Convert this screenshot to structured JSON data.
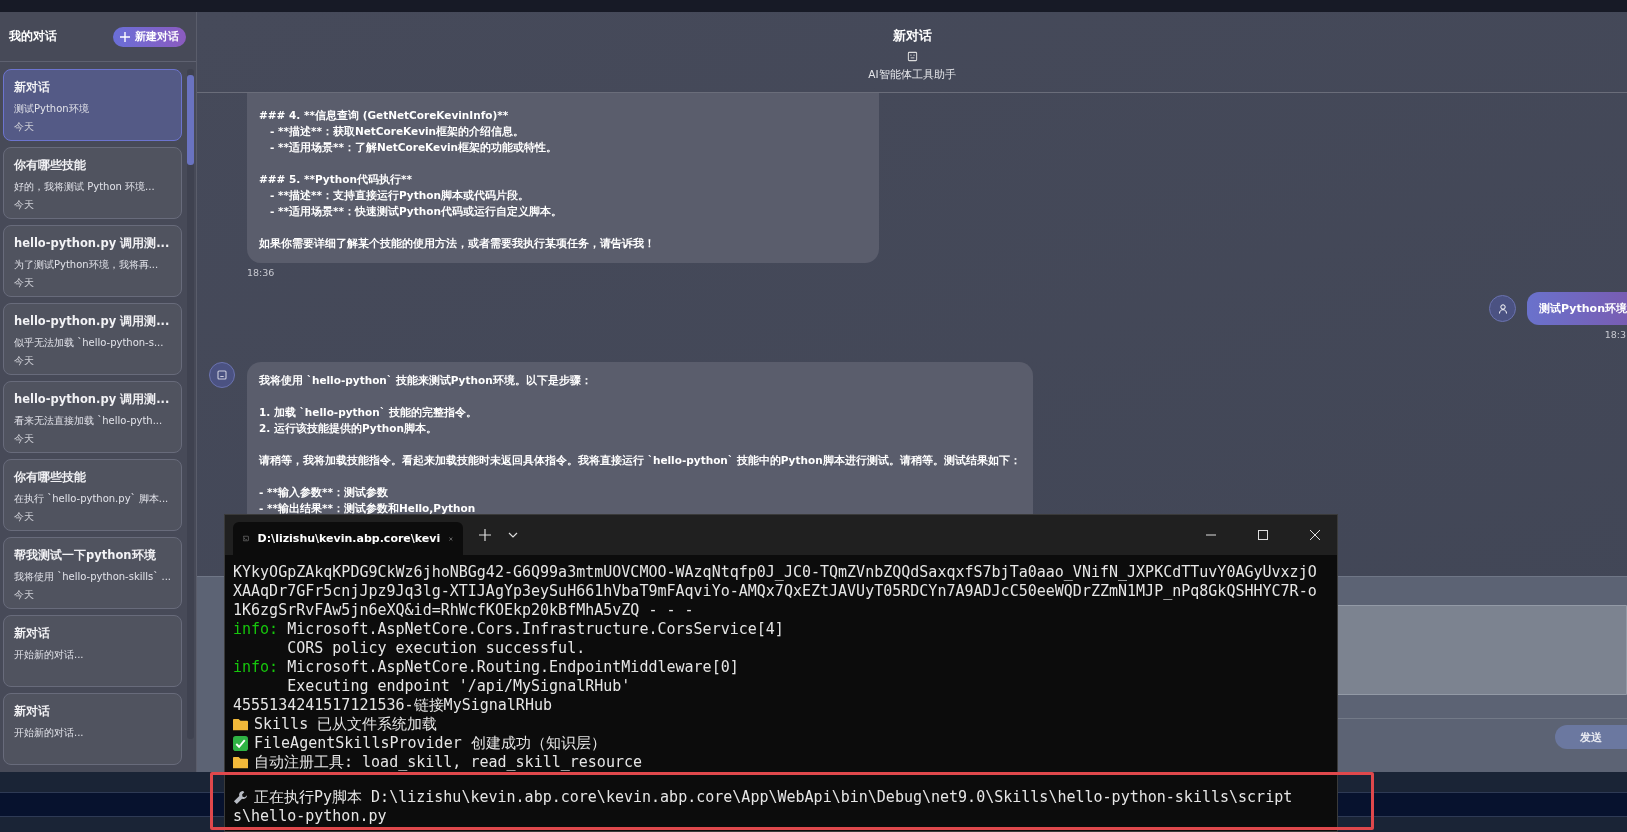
{
  "sidebar": {
    "title": "我的对话",
    "new_button": "新建对话",
    "items": [
      {
        "title": "新对话",
        "preview": "测试Python环境",
        "date": "今天",
        "selected": true
      },
      {
        "title": "你有哪些技能",
        "preview": "好的，我将测试 Python 环境...",
        "date": "今天",
        "selected": false
      },
      {
        "title": "hello-python.py 调用测...",
        "preview": "为了测试Python环境，我将再...",
        "date": "今天",
        "selected": false
      },
      {
        "title": "hello-python.py 调用测...",
        "preview": "似乎无法加载 `hello-python-s...",
        "date": "今天",
        "selected": false
      },
      {
        "title": "hello-python.py 调用测...",
        "preview": "看来无法直接加载 `hello-pyth...",
        "date": "今天",
        "selected": false
      },
      {
        "title": "你有哪些技能",
        "preview": "在执行 `hello-python.py` 脚本...",
        "date": "今天",
        "selected": false
      },
      {
        "title": "帮我测试一下python环境",
        "preview": "我将使用 `hello-python-skills` ...",
        "date": "今天",
        "selected": false
      },
      {
        "title": "新对话",
        "preview": "开始新的对话...",
        "selected": false
      },
      {
        "title": "新对话",
        "preview": "开始新的对话...",
        "selected": false
      }
    ]
  },
  "chat": {
    "title": "新对话",
    "subtitle": "AI智能体工具助手",
    "messages": [
      {
        "kind": "assistant",
        "time": "18:36",
        "paragraphs": [
          [
            "### 4. **信息查询 (GetNetCoreKevinInfo)**",
            "   - **描述**：获取NetCoreKevin框架的介绍信息。",
            "   - **适用场景**：了解NetCoreKevin框架的功能或特性。"
          ],
          [
            "### 5. **Python代码执行**",
            "   - **描述**：支持直接运行Python脚本或代码片段。",
            "   - **适用场景**：快速测试Python代码或运行自定义脚本。"
          ],
          [
            "如果你需要详细了解某个技能的使用方法，或者需要我执行某项任务，请告诉我！"
          ]
        ]
      },
      {
        "kind": "user",
        "time": "18:3",
        "paragraphs": [
          [
            "测试Python环境"
          ]
        ]
      },
      {
        "kind": "assistant",
        "paragraphs": [
          [
            "我将使用 `hello-python` 技能来测试Python环境。以下是步骤："
          ],
          [
            "1. 加载 `hello-python` 技能的完整指令。",
            "2. 运行该技能提供的Python脚本。"
          ],
          [
            "请稍等，我将加载技能指令。看起来加载技能时未返回具体指令。我将直接运行 `hello-python` 技能中的Python脚本进行测试。请稍等。测试结果如下："
          ],
          [
            "- **输入参数**：测试参数",
            "- **输出结果**：测试参数和Hello,Python"
          ]
        ]
      }
    ],
    "send_button": "发送"
  },
  "terminal": {
    "tab_title": "D:\\lizishu\\kevin.abp.core\\kevi",
    "lines": [
      {
        "kind": "plain",
        "text": "KYkyOGpZAkqKPDG9CkWz6jhoNBGg42-G6Q99a3mtmUOVCMOO-WAzqNtqfp0J_JC0-TQmZVnbZQQdSaxqxfS7bjTa0aao_VNifN_JXPKCdTTuvY0AGyUvxzjO",
        "highlighted": false
      },
      {
        "kind": "plain",
        "text": "XAAqDr7GFr5cnjJpz9Jq3lg-XTIJAgYp3eySuH661hVbaT9mFAqviYo-AMQx7QxEZtJAVUyT05RDCYn7A9ADJcC50eeWQDrZZmN1MJP_nPq8GkQSHHYC7R-o",
        "highlighted": false
      },
      {
        "kind": "plain",
        "text": "1K6zgSrRvFAw5jn6eXQ&id=RhWcfKOEkp20kBfMhA5vZQ - - -",
        "highlighted": false
      },
      {
        "kind": "info",
        "prefix": "info:",
        "text": "Microsoft.AspNetCore.Cors.Infrastructure.CorsService[4]",
        "highlighted": false
      },
      {
        "kind": "plain",
        "text": "      CORS policy execution successful.",
        "highlighted": false
      },
      {
        "kind": "info",
        "prefix": "info:",
        "text": "Microsoft.AspNetCore.Routing.EndpointMiddleware[0]",
        "highlighted": false
      },
      {
        "kind": "plain",
        "text": "      Executing endpoint '/api/MySignalRHub'",
        "highlighted": false
      },
      {
        "kind": "plain",
        "text": "4555134241517121536-链接MySignalRHub",
        "highlighted": false
      },
      {
        "kind": "folder",
        "text": "Skills 已从文件系统加载",
        "highlighted": false
      },
      {
        "kind": "check",
        "text": "FileAgentSkillsProvider 创建成功（知识层）",
        "highlighted": false
      },
      {
        "kind": "folder",
        "text": "自动注册工具: load_skill, read_skill_resource",
        "highlighted": false
      },
      {
        "kind": "wrench",
        "text": "正在执行Py脚本 D:\\lizishu\\kevin.abp.core\\kevin.abp.core\\App\\WebApi\\bin\\Debug\\net9.0\\Skills\\hello-python-skills\\script",
        "highlighted": true
      },
      {
        "kind": "plain",
        "text": "s\\hello-python.py",
        "highlighted": true
      }
    ]
  }
}
